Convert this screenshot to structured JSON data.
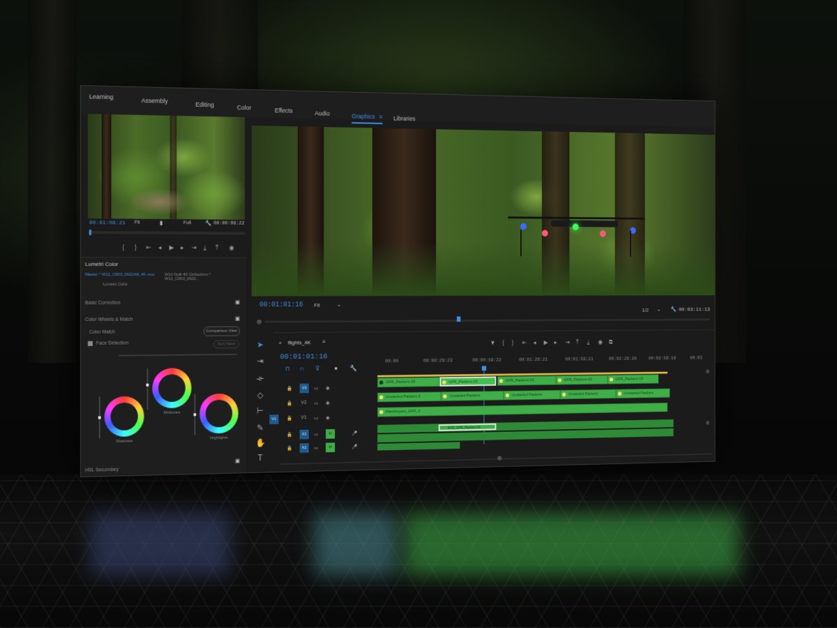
{
  "workspaces": {
    "tabs": [
      {
        "label": "Learning"
      },
      {
        "label": "Assembly"
      },
      {
        "label": "Editing"
      },
      {
        "label": "Color"
      },
      {
        "label": "Effects"
      },
      {
        "label": "Audio"
      },
      {
        "label": "Graphics"
      },
      {
        "label": "Libraries"
      }
    ],
    "active_index": 6,
    "active_menu_icon": "≡"
  },
  "source_monitor": {
    "timecode_in": "00:01:08:21",
    "fit_label": "Fit",
    "resolution": "Full",
    "timecode_duration": "00:00:08:22"
  },
  "lumetri": {
    "panel_title": "Lumetri Color",
    "clip_path": "Master * W12_C003_0622A8_4K.mov",
    "clip_path_2": "W12 Dolli 4K Orthochrm * W12_C003_0622...",
    "preset": "Lumetri Color",
    "section_basic": "Basic Correction",
    "section_wheels": "Color Wheels & Match",
    "color_match": "Color Match",
    "face_detection": "Face Detection",
    "comparison_view_button": "Comparison View",
    "apply_match_button": "Apply Match",
    "wheel_labels": [
      "Shadows",
      "Midtones",
      "Highlights"
    ],
    "section_hsl": "HSL Secondary"
  },
  "program_monitor": {
    "timecode": "00:01:01:16",
    "fit_label": "Fit",
    "resolution": "1/2",
    "timecode_duration": "00:03:11:13"
  },
  "timeline": {
    "sequence_name": "flights_4K",
    "timecode": "00:01:01:16",
    "ruler": [
      "00:00",
      "00:00:29:23",
      "00:00:59:22",
      "00:01:29:21",
      "00:01:59:21",
      "00:02:29:20",
      "00:02:59:19",
      "00:03"
    ],
    "tracks": {
      "video": [
        "V3",
        "V2",
        "V1"
      ],
      "audio": [
        "A1",
        "A2"
      ],
      "source_patch_video": "V1",
      "source_patch_audio": "A1"
    },
    "v3_clips": [
      "GFR_Packers 03",
      "GFR_Packers 03",
      "GFR_Packers 03",
      "GFR_Packers 03",
      "GFR_Packers 03"
    ],
    "v2_clips": [
      "Unstarted Packers 0",
      "Unstarted Packers",
      "Unstarted Packers",
      "Unstarted Packers",
      "Unstarted Packers"
    ],
    "v1_clips": [
      "Flamboyant_GFR_0"
    ],
    "audio_clips": [
      "W12_GFR_Packers 03"
    ]
  },
  "colors": {
    "accent_blue": "#3d8fe0",
    "clip_green": "#3fae49",
    "panel_bg": "#1b1b1b"
  }
}
